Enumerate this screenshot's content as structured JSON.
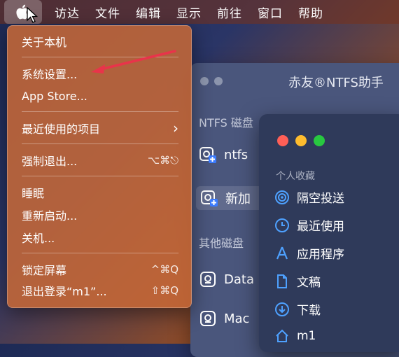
{
  "menubar": {
    "items": [
      "访达",
      "文件",
      "编辑",
      "显示",
      "前往",
      "窗口",
      "帮助"
    ]
  },
  "apple_menu": {
    "about": "关于本机",
    "settings": "系统设置...",
    "app_store": "App Store...",
    "recent": "最近使用的项目",
    "recent_arrow": "›",
    "force_quit": "强制退出...",
    "force_quit_shortcut": "⌥⌘⎋",
    "sleep": "睡眠",
    "restart": "重新启动...",
    "shutdown": "关机...",
    "lock": "锁定屏幕",
    "lock_shortcut": "^⌘Q",
    "logout": "退出登录“m1”...",
    "logout_shortcut": "⇧⌘Q"
  },
  "ntfs_window": {
    "title": "赤友®NTFS助手",
    "section_ntfs": "NTFS 磁盘",
    "disks": [
      "ntfs",
      "新加"
    ],
    "section_other": "其他磁盘",
    "other_disks": [
      "Data",
      "Mac"
    ]
  },
  "finder_sidebar": {
    "section": "个人收藏",
    "items": [
      "隔空投送",
      "最近使用",
      "应用程序",
      "文稿",
      "下载",
      "m1"
    ],
    "colors": {
      "red": "#ff5f57",
      "yellow": "#febc2e",
      "green": "#28c840",
      "accent": "#4ea1ff"
    }
  },
  "annotation": {
    "arrow_color": "#e8344a"
  }
}
